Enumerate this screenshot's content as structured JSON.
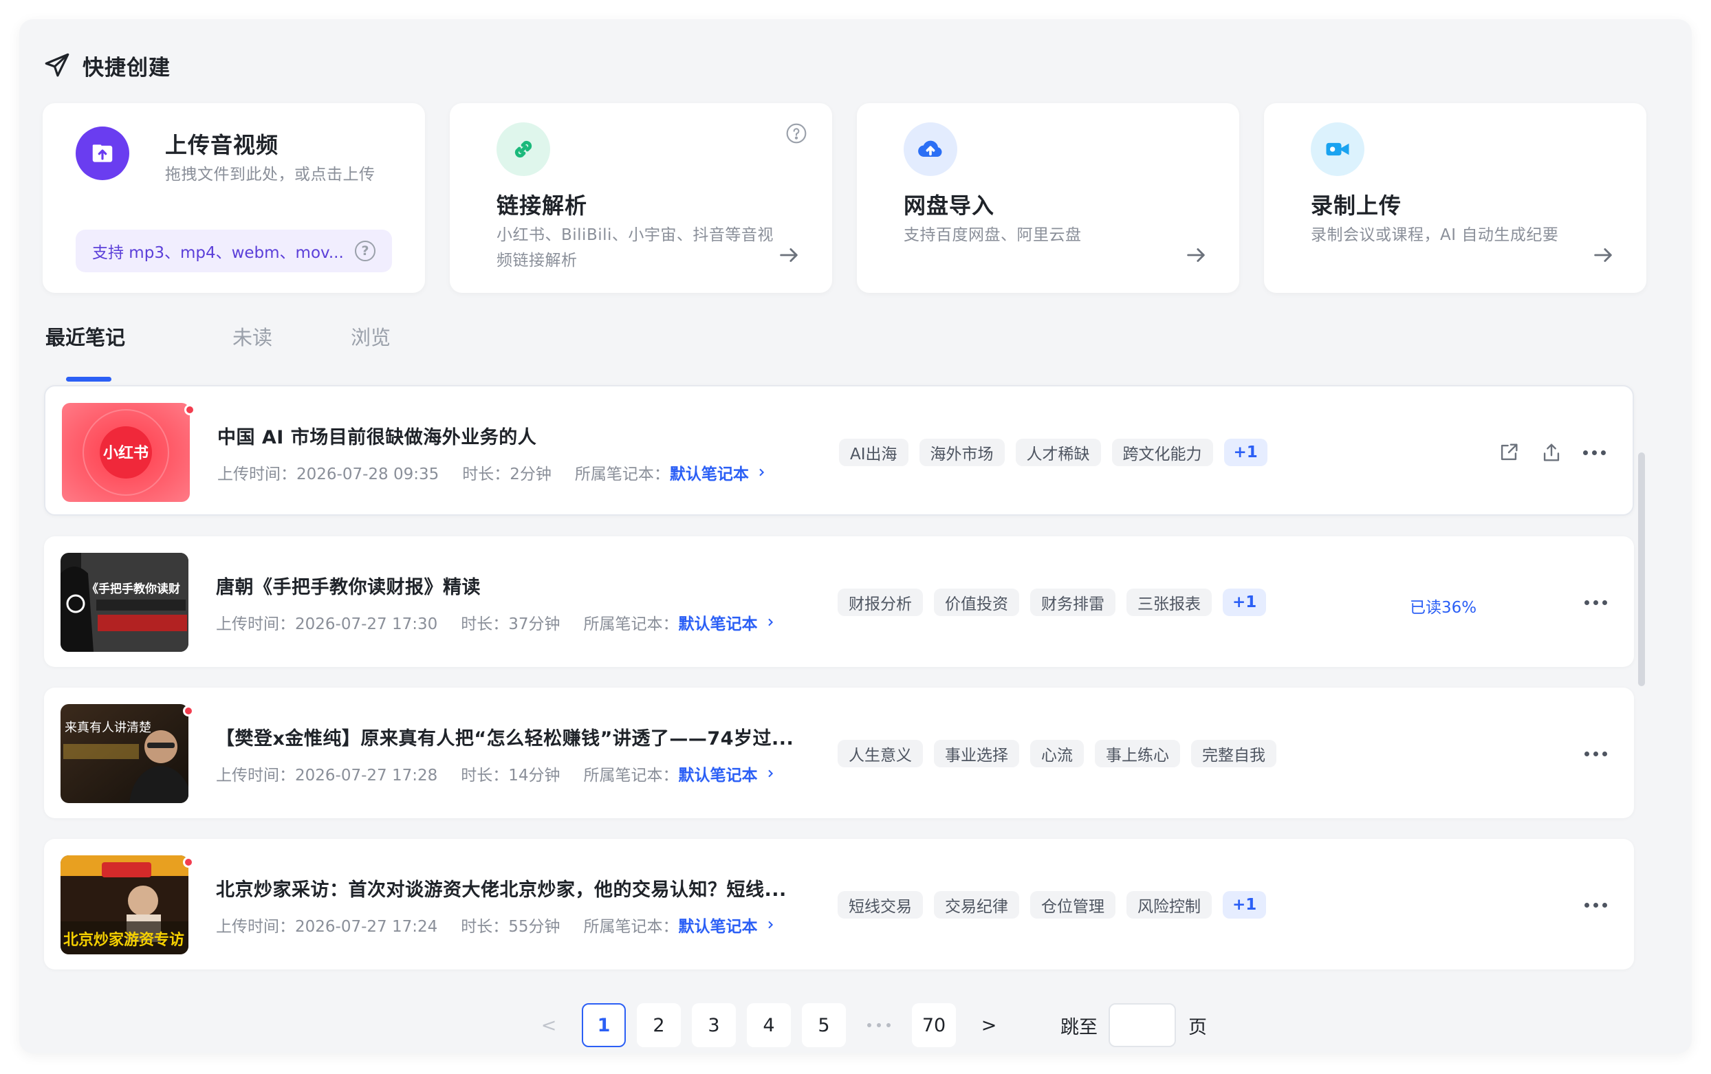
{
  "quick_create": {
    "title": "快捷创建",
    "cards": [
      {
        "title": "上传音视频",
        "desc": "拖拽文件到此处，或点击上传",
        "support": "支持 mp3、mp4、webm、mov...",
        "icon": "upload-folder-icon",
        "color": "#6a3df0"
      },
      {
        "title": "链接解析",
        "desc": "小红书、BiliBili、小宇宙、抖音等音视频链接解析",
        "icon": "link-icon",
        "color": "#1bb97b"
      },
      {
        "title": "网盘导入",
        "desc": "支持百度网盘、阿里云盘",
        "icon": "cloud-upload-icon",
        "color": "#2b6ff5"
      },
      {
        "title": "录制上传",
        "desc": "录制会议或课程，AI 自动生成纪要",
        "icon": "video-camera-icon",
        "color": "#1aa3f0"
      }
    ]
  },
  "tabs": [
    {
      "label": "最近笔记",
      "active": true
    },
    {
      "label": "未读",
      "active": false
    },
    {
      "label": "浏览",
      "active": false
    }
  ],
  "notes": [
    {
      "title": "中国 AI 市场目前很缺做海外业务的人",
      "upload": "上传时间：2026-07-28 09:35",
      "duration": "时长：2分钟",
      "notebook_label": "所属笔记本：",
      "notebook": "默认笔记本",
      "tags": [
        "AI出海",
        "海外市场",
        "人才稀缺",
        "跨文化能力"
      ],
      "more": "+1",
      "read": "",
      "thumb_text": "小红书",
      "unread": true
    },
    {
      "title": "唐朝《手把手教你读财报》精读",
      "upload": "上传时间：2026-07-27 17:30",
      "duration": "时长：37分钟",
      "notebook_label": "所属笔记本：",
      "notebook": "默认笔记本",
      "tags": [
        "财报分析",
        "价值投资",
        "财务排雷",
        "三张报表"
      ],
      "more": "+1",
      "read": "已读36%",
      "thumb_text": "《手把手教你读财",
      "unread": false
    },
    {
      "title": "【樊登x金惟纯】原来真有人把“怎么轻松赚钱”讲透了——74岁过...",
      "upload": "上传时间：2026-07-27 17:28",
      "duration": "时长：14分钟",
      "notebook_label": "所属笔记本：",
      "notebook": "默认笔记本",
      "tags": [
        "人生意义",
        "事业选择",
        "心流",
        "事上练心",
        "完整自我"
      ],
      "more": "",
      "read": "",
      "thumb_text": "来真有人讲清楚",
      "unread": true
    },
    {
      "title": "北京炒家采访：首次对谈游资大佬北京炒家，他的交易认知？短线...",
      "upload": "上传时间：2026-07-27 17:24",
      "duration": "时长：55分钟",
      "notebook_label": "所属笔记本：",
      "notebook": "默认笔记本",
      "tags": [
        "短线交易",
        "交易纪律",
        "仓位管理",
        "风险控制"
      ],
      "more": "+1",
      "read": "",
      "thumb_text": "北京炒家游资专访",
      "unread": true
    }
  ],
  "pagination": {
    "prev": "<",
    "pages": [
      "1",
      "2",
      "3",
      "4",
      "5"
    ],
    "last": "70",
    "next": ">",
    "current": 1,
    "jump_label": "跳至",
    "page_suffix": "页"
  },
  "colors": {
    "accent": "#2b5ff5",
    "unread_dot": "#f23d4f"
  }
}
